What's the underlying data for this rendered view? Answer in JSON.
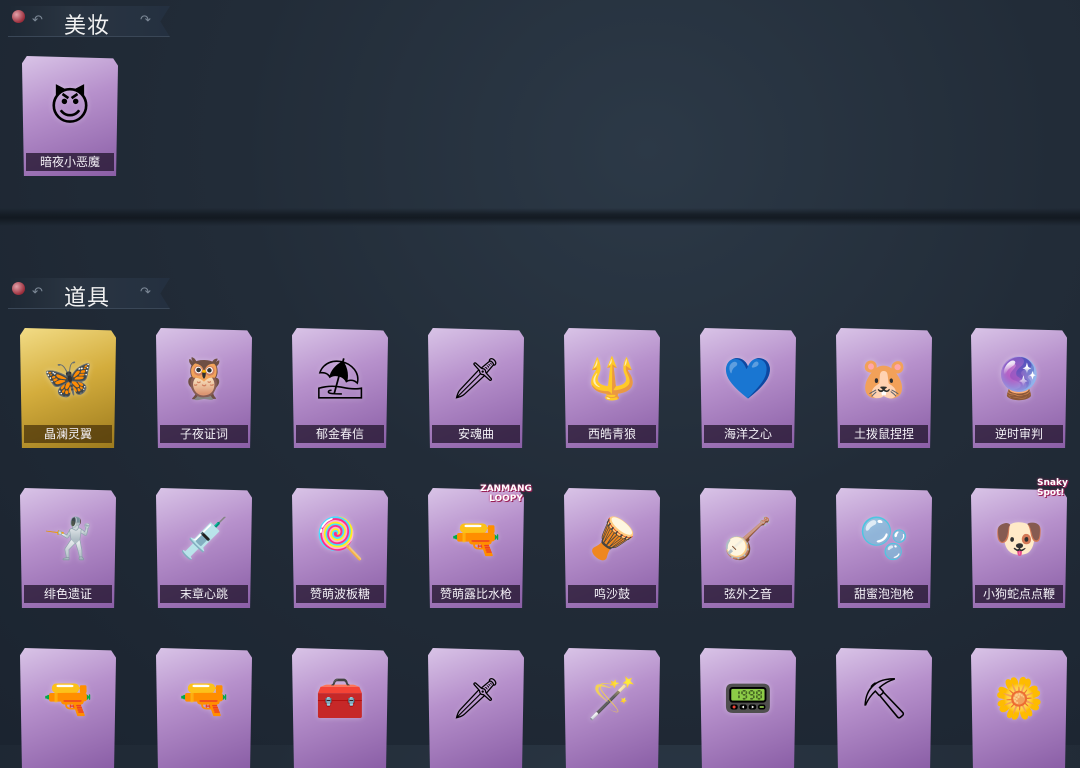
{
  "sections": {
    "makeup": {
      "title": "美妆"
    },
    "props": {
      "title": "道具"
    }
  },
  "makeup_items": [
    {
      "name": "暗夜小恶魔",
      "icon": "devil-face-icon",
      "glyph": "😈"
    }
  ],
  "prop_items": [
    {
      "name": "晶澜灵翼",
      "icon": "crystal-wings-icon",
      "glyph": "🦋",
      "rarity": "gold"
    },
    {
      "name": "子夜证词",
      "icon": "owl-doll-icon",
      "glyph": "🦉"
    },
    {
      "name": "郁金春信",
      "icon": "parasol-icon",
      "glyph": "⛱"
    },
    {
      "name": "安魂曲",
      "icon": "blade-icon",
      "glyph": "🗡"
    },
    {
      "name": "西皓青狼",
      "icon": "golden-staff-icon",
      "glyph": "🔱"
    },
    {
      "name": "海洋之心",
      "icon": "heart-gem-icon",
      "glyph": "💙"
    },
    {
      "name": "土拨鼠捏捏",
      "icon": "hamster-icon",
      "glyph": "🐹"
    },
    {
      "name": "逆时审判",
      "icon": "pocket-watch-icon",
      "glyph": "🔮"
    },
    {
      "name": "绯色遗证",
      "icon": "rapier-icon",
      "glyph": "🤺"
    },
    {
      "name": "末章心跳",
      "icon": "syringe-icon",
      "glyph": "💉"
    },
    {
      "name": "赞萌波板糖",
      "icon": "lollipop-icon",
      "glyph": "🍭"
    },
    {
      "name": "赞萌露比水枪",
      "icon": "water-gun-icon",
      "glyph": "🔫",
      "badge": "ZANMANG LOOPY"
    },
    {
      "name": "鸣沙鼓",
      "icon": "drum-icon",
      "glyph": "🪘"
    },
    {
      "name": "弦外之音",
      "icon": "lute-icon",
      "glyph": "🪕"
    },
    {
      "name": "甜蜜泡泡枪",
      "icon": "bubble-gun-icon",
      "glyph": "🫧"
    },
    {
      "name": "小狗蛇点点鞭",
      "icon": "dog-whip-icon",
      "glyph": "🐶",
      "badge": "Snaky Spot!"
    },
    {
      "name": "",
      "icon": "shotgun-icon",
      "glyph": "🔫"
    },
    {
      "name": "",
      "icon": "revolver-icon",
      "glyph": "🔫"
    },
    {
      "name": "",
      "icon": "first-aid-kit-icon",
      "glyph": "🧰"
    },
    {
      "name": "",
      "icon": "curved-blade-icon",
      "glyph": "🗡"
    },
    {
      "name": "",
      "icon": "magic-wand-icon",
      "glyph": "🪄"
    },
    {
      "name": "",
      "icon": "toy-device-icon",
      "glyph": "📟"
    },
    {
      "name": "",
      "icon": "shovel-icon",
      "glyph": "⛏"
    },
    {
      "name": "",
      "icon": "flower-pendant-icon",
      "glyph": "🌼"
    }
  ]
}
